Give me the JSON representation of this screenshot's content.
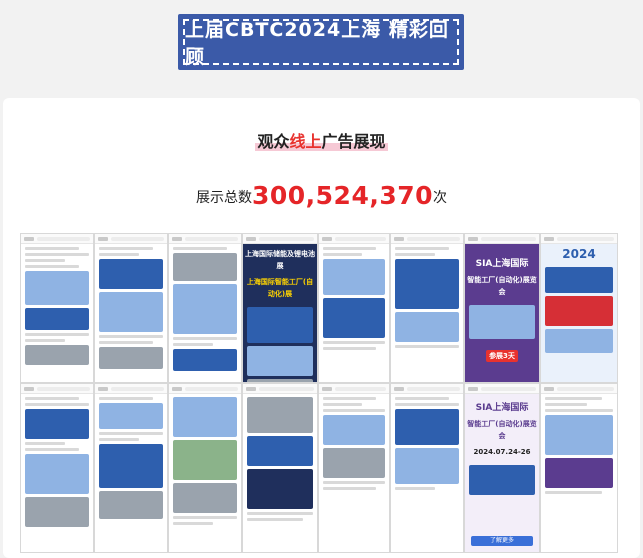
{
  "header": {
    "title": "上届CBTC2024上海 精彩回顾"
  },
  "section": {
    "title_prefix": "观众",
    "title_highlight": "线上",
    "title_suffix": "广告展现"
  },
  "stat": {
    "prefix": "展示总数",
    "value": "300,524,370",
    "suffix": "次"
  },
  "screenshots": {
    "poster_line1": "上海国际储能及锂电池展",
    "poster_line2": "上海国际智能工厂(自动化)展",
    "poster_sia1": "SIA上海国际",
    "poster_sia2": "智能工厂(自动化)展览会",
    "poster_year": "2024",
    "poster_sia3": "SIA上海国际",
    "poster_sia4": "智能工厂(自动化)展览会",
    "poster_date": "2024.07.24-26",
    "tag_text": "参展3天",
    "bottom_btn": "了解更多"
  },
  "colors": {
    "banner": "#3b5aa8",
    "accent_red": "#e52528",
    "highlight": "#f6c9d5"
  }
}
